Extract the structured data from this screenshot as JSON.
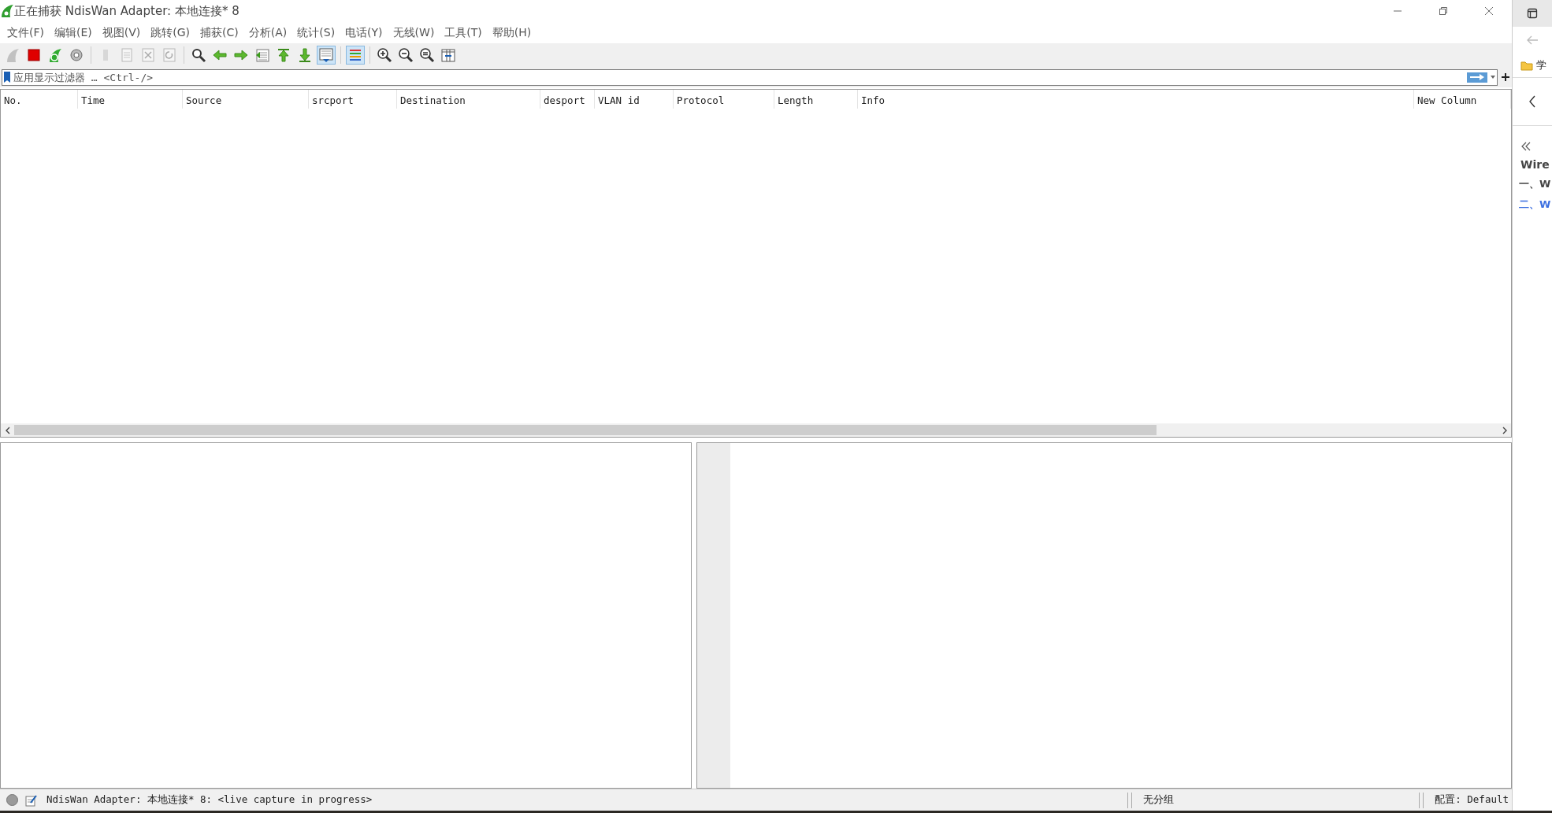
{
  "window": {
    "title": "正在捕获 NdisWan Adapter: 本地连接* 8"
  },
  "menu": [
    "文件(F)",
    "编辑(E)",
    "视图(V)",
    "跳转(G)",
    "捕获(C)",
    "分析(A)",
    "统计(S)",
    "电话(Y)",
    "无线(W)",
    "工具(T)",
    "帮助(H)"
  ],
  "toolbar": [
    {
      "kind": "fin",
      "on": false,
      "disabled": true
    },
    {
      "kind": "stop",
      "on": false,
      "disabled": false
    },
    {
      "kind": "restart",
      "on": false,
      "disabled": false
    },
    {
      "kind": "gear",
      "on": false,
      "disabled": false
    },
    {
      "kind": "sep"
    },
    {
      "kind": "file",
      "on": false,
      "disabled": true
    },
    {
      "kind": "doc",
      "on": false,
      "disabled": true
    },
    {
      "kind": "closedoc",
      "on": false,
      "disabled": true
    },
    {
      "kind": "reload",
      "on": false,
      "disabled": true
    },
    {
      "kind": "sep"
    },
    {
      "kind": "search",
      "on": false,
      "disabled": false
    },
    {
      "kind": "left",
      "on": false,
      "disabled": false
    },
    {
      "kind": "right",
      "on": false,
      "disabled": false
    },
    {
      "kind": "goto",
      "on": false,
      "disabled": false
    },
    {
      "kind": "first",
      "on": false,
      "disabled": false
    },
    {
      "kind": "last",
      "on": false,
      "disabled": false
    },
    {
      "kind": "autoscroll",
      "on": true,
      "disabled": false
    },
    {
      "kind": "sep"
    },
    {
      "kind": "colorize",
      "on": true,
      "disabled": false
    },
    {
      "kind": "sep"
    },
    {
      "kind": "zoomin",
      "on": false,
      "disabled": false
    },
    {
      "kind": "zoomout",
      "on": false,
      "disabled": false
    },
    {
      "kind": "zoomreset",
      "on": false,
      "disabled": false
    },
    {
      "kind": "resize",
      "on": false,
      "disabled": false
    }
  ],
  "filter": {
    "placeholder": "应用显示过滤器 … <Ctrl-/>"
  },
  "table": {
    "columns": [
      "No.",
      "Time",
      "Source",
      "srcport",
      "Destination",
      "desport",
      "VLAN id",
      "Protocol",
      "Length",
      "Info",
      "New Column"
    ]
  },
  "status_bar": {
    "capture": "NdisWan Adapter: 本地连接* 8: <live capture in progress>",
    "packets": "无分组",
    "profile": "配置: Default"
  },
  "side_panel": {
    "bookmark": "学",
    "heading": "Wire",
    "items": [
      {
        "text": "一、W",
        "selected": false
      },
      {
        "text": "二、W",
        "selected": true
      }
    ]
  }
}
